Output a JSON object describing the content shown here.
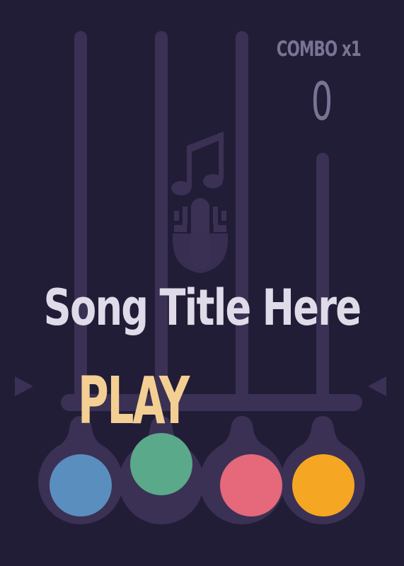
{
  "hud": {
    "combo_label": "COMBO x1",
    "score": "0"
  },
  "song": {
    "title": "Song Title Here"
  },
  "menu": {
    "play_label": "PLAY"
  },
  "colors": {
    "background": "#221d36",
    "lane": "#3b3154",
    "button_socket": "#3b3154",
    "lane_blue": "#5a8ebf",
    "lane_green": "#5aa98a",
    "lane_red": "#e5697a",
    "lane_orange": "#f5a623",
    "play_text": "#f3cf93",
    "title_text": "#dfdbe9",
    "hud_text": "#7b7393"
  },
  "lanes": [
    {
      "color_name": "blue"
    },
    {
      "color_name": "green"
    },
    {
      "color_name": "red"
    },
    {
      "color_name": "orange"
    }
  ]
}
